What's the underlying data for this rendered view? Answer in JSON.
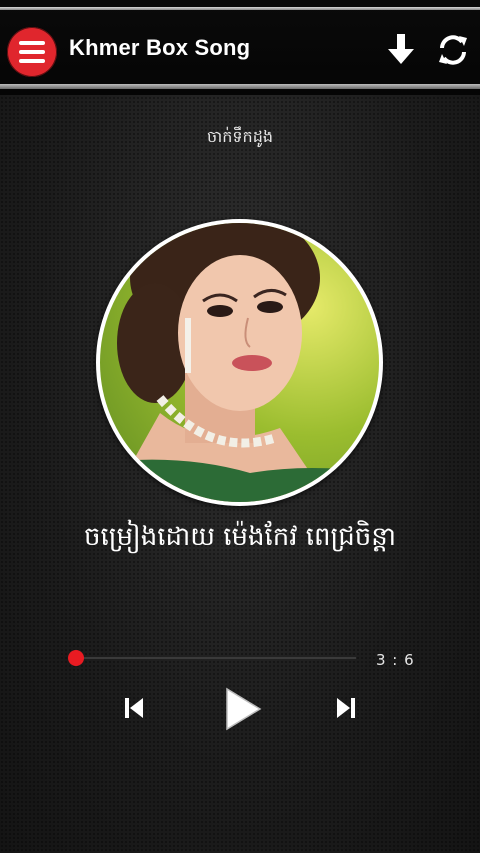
{
  "header": {
    "title": "Khmer Box Song",
    "menu_icon": "hamburger-menu-icon",
    "download_icon": "download-arrow-icon",
    "refresh_icon": "refresh-icon"
  },
  "player": {
    "subtitle": "ចាក់ទឹកដូង",
    "song_title": "ចម្រៀងដោយ  ម៉េងកែវ ពេជ្រចិន្តា",
    "time": "3 : 6",
    "progress": 0.0
  },
  "colors": {
    "accent": "#e0262d",
    "progress_knob": "#e81b22",
    "header_bg": "#050505",
    "text": "#ffffff"
  },
  "controls": {
    "previous_icon": "skip-previous-icon",
    "play_icon": "play-icon",
    "next_icon": "skip-next-icon"
  }
}
